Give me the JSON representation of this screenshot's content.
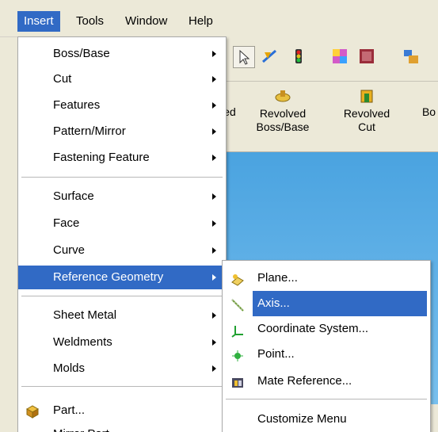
{
  "menubar": {
    "items": [
      {
        "label": "Insert"
      },
      {
        "label": "Tools"
      },
      {
        "label": "Window"
      },
      {
        "label": "Help"
      }
    ]
  },
  "features": {
    "partial_left": "ed",
    "revolved_boss": {
      "line1": "Revolved",
      "line2": "Boss/Base"
    },
    "revolved_cut": {
      "line1": "Revolved",
      "line2": "Cut"
    },
    "partial_right": "Bo"
  },
  "insert_menu": {
    "items": [
      {
        "label": "Boss/Base"
      },
      {
        "label": "Cut"
      },
      {
        "label": "Features"
      },
      {
        "label": "Pattern/Mirror"
      },
      {
        "label": "Fastening Feature"
      },
      {
        "label": "Surface"
      },
      {
        "label": "Face"
      },
      {
        "label": "Curve"
      },
      {
        "label": "Reference Geometry"
      },
      {
        "label": "Sheet Metal"
      },
      {
        "label": "Weldments"
      },
      {
        "label": "Molds"
      },
      {
        "label": "Part..."
      },
      {
        "label": "Mirror Part..."
      }
    ]
  },
  "ref_geometry_submenu": {
    "items": [
      {
        "label": "Plane..."
      },
      {
        "label": "Axis..."
      },
      {
        "label": "Coordinate System..."
      },
      {
        "label": "Point..."
      },
      {
        "label": "Mate Reference..."
      },
      {
        "label": "Customize Menu"
      }
    ]
  },
  "colors": {
    "highlight": "#316ac5",
    "workarea": "#4aa3e0",
    "chrome": "#ece9d8"
  }
}
